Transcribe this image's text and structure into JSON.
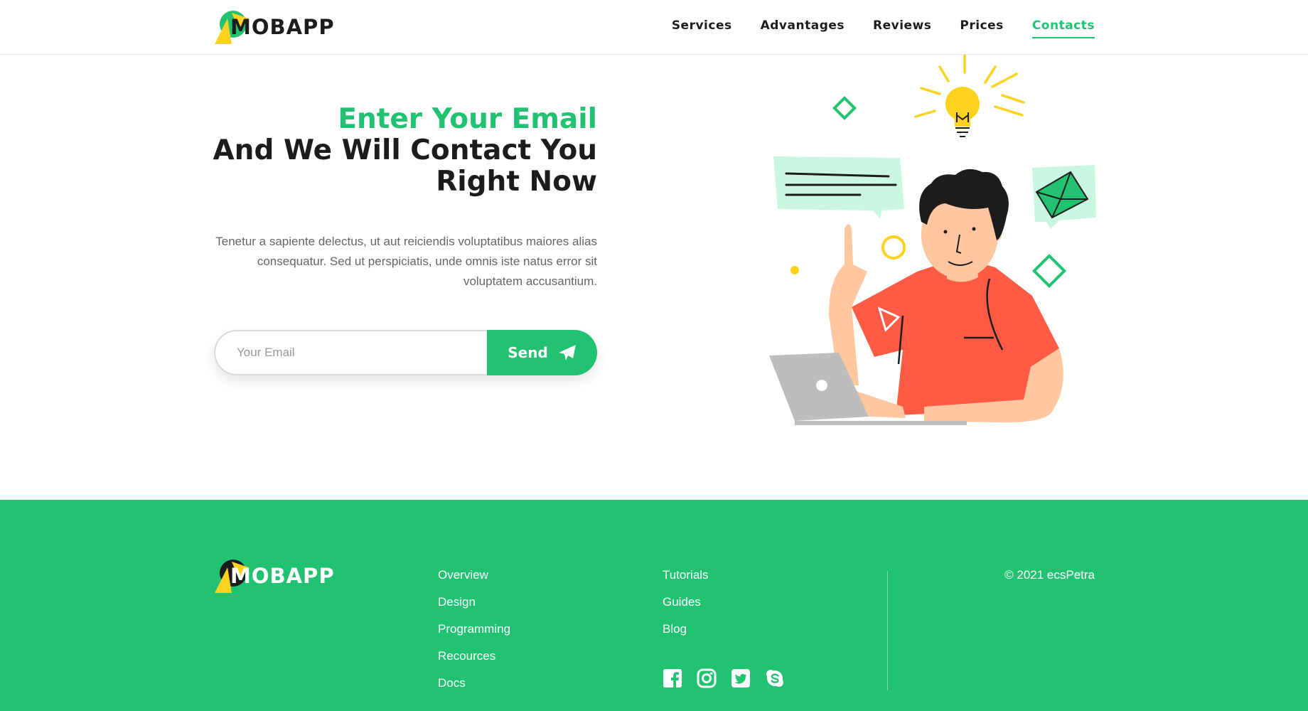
{
  "brand": {
    "name": "MOBAPP",
    "accent": "#21c272",
    "yellow": "#ffd21f"
  },
  "nav": {
    "items": [
      {
        "label": "Services",
        "active": false
      },
      {
        "label": "Advantages",
        "active": false
      },
      {
        "label": "Reviews",
        "active": false
      },
      {
        "label": "Prices",
        "active": false
      },
      {
        "label": "Contacts",
        "active": true
      }
    ]
  },
  "hero": {
    "title_green": "Enter Your Email",
    "title_line2": "And We Will Contact You",
    "title_line3": "Right Now",
    "description": "Tenetur a sapiente delectus, ut aut reiciendis voluptatibus maiores alias consequatur. Sed ut perspiciatis, unde omnis iste natus error sit voluptatem accusantium."
  },
  "form": {
    "email_placeholder": "Your Email",
    "email_value": "",
    "send_label": "Send",
    "send_icon": "paper-plane-icon"
  },
  "footer": {
    "col1": [
      "Overview",
      "Design",
      "Programming",
      "Recources",
      "Docs"
    ],
    "col2": [
      "Tutorials",
      "Guides",
      "Blog"
    ],
    "socials": [
      "facebook-icon",
      "instagram-icon",
      "twitter-icon",
      "skype-icon"
    ],
    "copyright": "© 2021 ecsPetra"
  }
}
